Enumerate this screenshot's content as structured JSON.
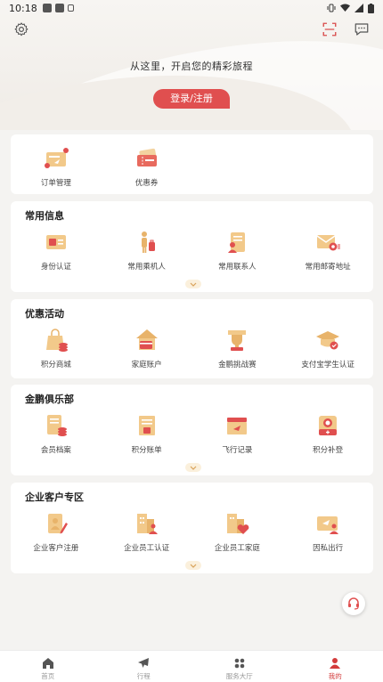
{
  "status_bar": {
    "time": "10:18"
  },
  "header": {
    "tagline": "从这里，开启您的精彩旅程",
    "login_button": "登录/注册"
  },
  "quick_card": {
    "items": [
      {
        "label": "订单管理",
        "icon": "order-icon"
      },
      {
        "label": "优惠券",
        "icon": "coupon-icon"
      }
    ]
  },
  "sections": [
    {
      "title": "常用信息",
      "items": [
        {
          "label": "身份认证",
          "icon": "id-card-icon"
        },
        {
          "label": "常用乘机人",
          "icon": "passenger-icon"
        },
        {
          "label": "常用联系人",
          "icon": "contact-icon"
        },
        {
          "label": "常用邮寄地址",
          "icon": "mail-address-icon"
        }
      ]
    },
    {
      "title": "优惠活动",
      "items": [
        {
          "label": "积分商城",
          "icon": "points-mall-icon"
        },
        {
          "label": "家庭账户",
          "icon": "family-account-icon"
        },
        {
          "label": "金鹏挑战赛",
          "icon": "trophy-icon"
        },
        {
          "label": "支付宝学生认证",
          "icon": "student-icon"
        }
      ]
    },
    {
      "title": "金鹏俱乐部",
      "items": [
        {
          "label": "会员档案",
          "icon": "member-profile-icon"
        },
        {
          "label": "积分账单",
          "icon": "points-bill-icon"
        },
        {
          "label": "飞行记录",
          "icon": "flight-record-icon"
        },
        {
          "label": "积分补登",
          "icon": "points-makeup-icon"
        }
      ]
    },
    {
      "title": "企业客户专区",
      "items": [
        {
          "label": "企业客户注册",
          "icon": "enterprise-register-icon"
        },
        {
          "label": "企业员工认证",
          "icon": "employee-verify-icon"
        },
        {
          "label": "企业员工家庭",
          "icon": "employee-family-icon"
        },
        {
          "label": "因私出行",
          "icon": "private-travel-icon"
        }
      ]
    }
  ],
  "bottom_nav": [
    {
      "label": "首页",
      "icon": "home-icon",
      "active": false
    },
    {
      "label": "行程",
      "icon": "plane-icon",
      "active": false
    },
    {
      "label": "服务大厅",
      "icon": "grid-icon",
      "active": false
    },
    {
      "label": "我的",
      "icon": "user-icon",
      "active": true
    }
  ],
  "colors": {
    "accent": "#e04f4f",
    "gold": "#e8b36a",
    "active_nav": "#d33b3b"
  }
}
